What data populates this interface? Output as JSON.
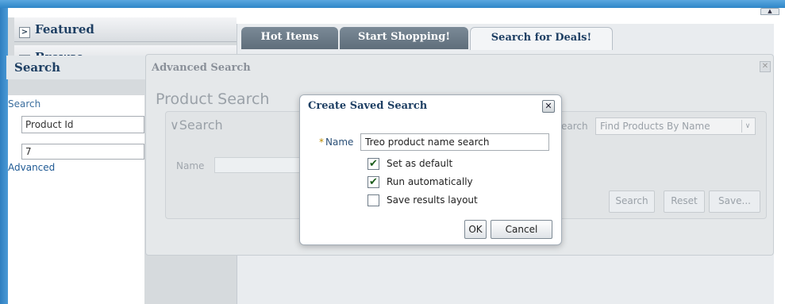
{
  "left_panel": {
    "accordion": [
      {
        "label": "Featured",
        "arrow": ">"
      },
      {
        "label": "Browse",
        "arrow": ">"
      }
    ],
    "search_header": "Search",
    "search_subheading": "Search",
    "search_by_value": "Product Id",
    "search_term_value": "7",
    "advanced_link": "Advanced"
  },
  "tabs": [
    {
      "label": "Hot Items"
    },
    {
      "label": "Start Shopping!"
    },
    {
      "label": "Search for Deals!",
      "selected": true
    }
  ],
  "advanced_search": {
    "title": "Advanced Search",
    "close_glyph": "✕",
    "heading": "Product Search",
    "section_toggle": "∨",
    "section_title": "Search",
    "saved_search_label": "earch",
    "saved_search_value": "Find Products By Name",
    "saved_search_arrow": "∨",
    "name_label": "Name",
    "buttons": {
      "search": "Search",
      "reset": "Reset",
      "save": "Save..."
    }
  },
  "modal": {
    "title": "Create Saved Search",
    "close_glyph": "✕",
    "required_marker": "*",
    "name_label": "Name",
    "name_value": "Treo product name search",
    "options": [
      {
        "label": "Set as default",
        "checked": true,
        "glyph": "✔"
      },
      {
        "label": "Run automatically",
        "checked": true,
        "glyph": "✔"
      },
      {
        "label": "Save results layout",
        "checked": false,
        "glyph": ""
      }
    ],
    "ok_label": "OK",
    "cancel_label": "Cancel"
  },
  "top_scroll_glyph": "▲",
  "colors": {
    "brand_blue": "#2f86c8",
    "header_text": "#1e3f63",
    "link": "#1f5a94",
    "tab_dark": "#6b7a87"
  }
}
